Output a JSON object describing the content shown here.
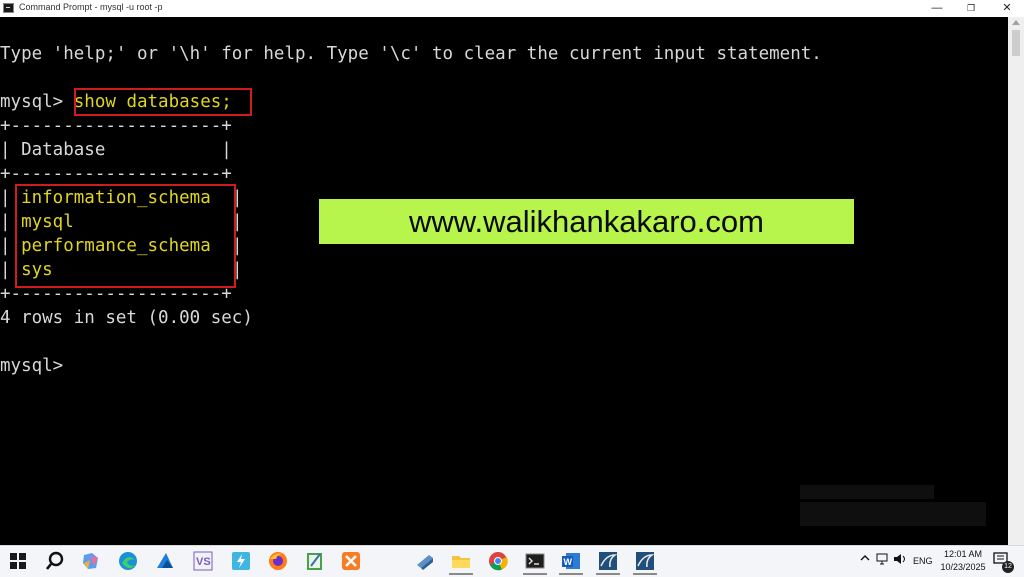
{
  "window": {
    "title": "Command Prompt - mysql  -u root -p",
    "minimize_glyph": "—",
    "maximize_glyph": "❐",
    "close_glyph": "✕"
  },
  "console": {
    "help_line": "Type 'help;' or '\\h' for help. Type '\\c' to clear the current input statement.",
    "prompt": "mysql> ",
    "command": "show databases;",
    "table_border": "+--------------------+",
    "table_header": "| Database           |",
    "rows": [
      "information_schema",
      "mysql",
      "performance_schema",
      "sys"
    ],
    "result_summary": "4 rows in set (0.00 sec)",
    "final_prompt": "mysql>"
  },
  "watermark": {
    "text": "www.walikhankakaro.com",
    "bg_color": "#b7f44c"
  },
  "colors": {
    "command_text": "#e1d51e",
    "highlight_border": "#d01c1c",
    "console_bg": "#000000",
    "console_text": "#d8d8d8"
  },
  "taskbar": {
    "icons": [
      "windows-start-icon",
      "search-icon",
      "copilot-icon",
      "edge-icon",
      "app-icon",
      "vs-icon",
      "app-icon",
      "firefox-icon",
      "notepad-icon",
      "xampp-icon",
      "app-icon",
      "file-explorer-icon",
      "chrome-icon",
      "terminal-icon",
      "word-icon",
      "mysql-icon",
      "mysql-icon"
    ],
    "language": "ENG",
    "time": "12:01 AM",
    "date": "10/23/2025",
    "notifications": "12"
  }
}
